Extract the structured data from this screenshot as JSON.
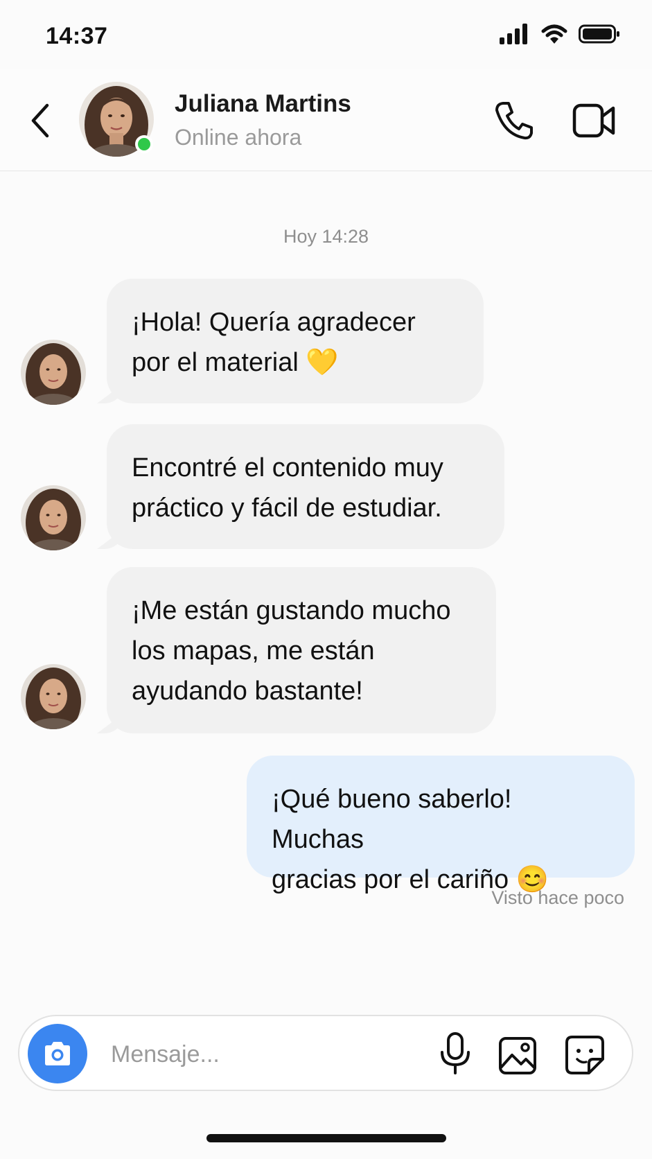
{
  "status_bar": {
    "time": "14:37"
  },
  "header": {
    "contact_name": "Juliana Martins",
    "contact_status": "Online ahora",
    "online_color": "#2fc84a"
  },
  "chat": {
    "timestamp": "Hoy 14:28",
    "messages": [
      {
        "direction": "incoming",
        "lines": [
          "¡Hola! Quería agradecer",
          "por el material 💛"
        ]
      },
      {
        "direction": "incoming",
        "lines": [
          "Encontré el contenido muy",
          "práctico y fácil de estudiar."
        ]
      },
      {
        "direction": "incoming",
        "lines": [
          "¡Me están gustando mucho",
          "los mapas, me están",
          "ayudando bastante!"
        ]
      },
      {
        "direction": "outgoing",
        "lines": [
          "¡Qué bueno saberlo! Muchas",
          "gracias por el cariño 😊"
        ]
      }
    ],
    "seen_label": "Visto hace poco"
  },
  "composer": {
    "placeholder": "Mensaje...",
    "accent_color": "#3b86f0",
    "icons": [
      "camera-icon",
      "microphone-icon",
      "image-icon",
      "sticker-icon"
    ]
  }
}
